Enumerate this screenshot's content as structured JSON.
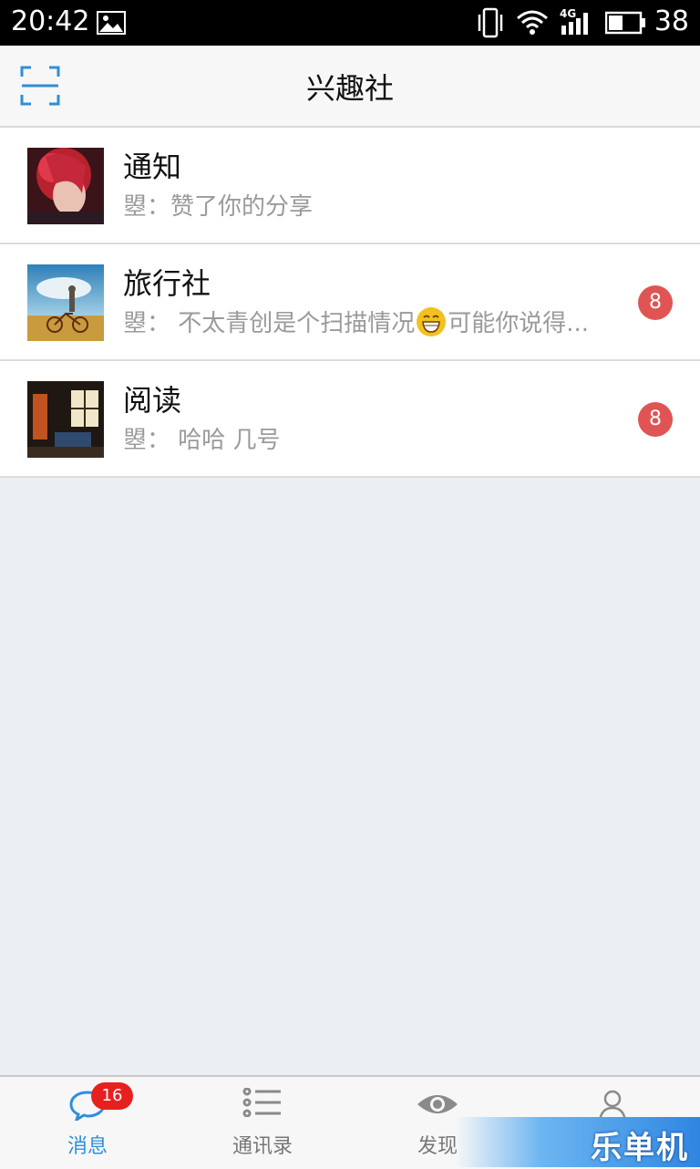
{
  "status_bar": {
    "time": "20:42",
    "network": "4G",
    "battery": "38",
    "icons": [
      "image-icon",
      "vibrate-icon",
      "wifi-icon",
      "signal-icon",
      "battery-icon"
    ]
  },
  "header": {
    "title": "兴趣社",
    "scan_icon": "scan-icon"
  },
  "conversations": [
    {
      "name": "通知",
      "preview": "曌：赞了你的分享",
      "badge": ""
    },
    {
      "name": "旅行社",
      "preview_before": "曌： 不太青创是个扫描情况",
      "preview_after": "可能你说得...",
      "badge": "8"
    },
    {
      "name": "阅读",
      "preview": "曌： 哈哈 几号",
      "badge": "8"
    }
  ],
  "bottom_nav": {
    "items": [
      {
        "label": "消息",
        "icon": "chat-bubble-icon",
        "badge": "16",
        "active": true
      },
      {
        "label": "通讯录",
        "icon": "contacts-list-icon",
        "active": false
      },
      {
        "label": "发现",
        "icon": "eye-icon",
        "active": false
      },
      {
        "label": "",
        "icon": "person-icon",
        "active": false
      }
    ]
  },
  "watermark": "乐单机",
  "colors": {
    "accent": "#2f8fd8",
    "badge_red": "#e05454",
    "nav_badge_red": "#e81f1f",
    "background": "#ebeef2"
  }
}
